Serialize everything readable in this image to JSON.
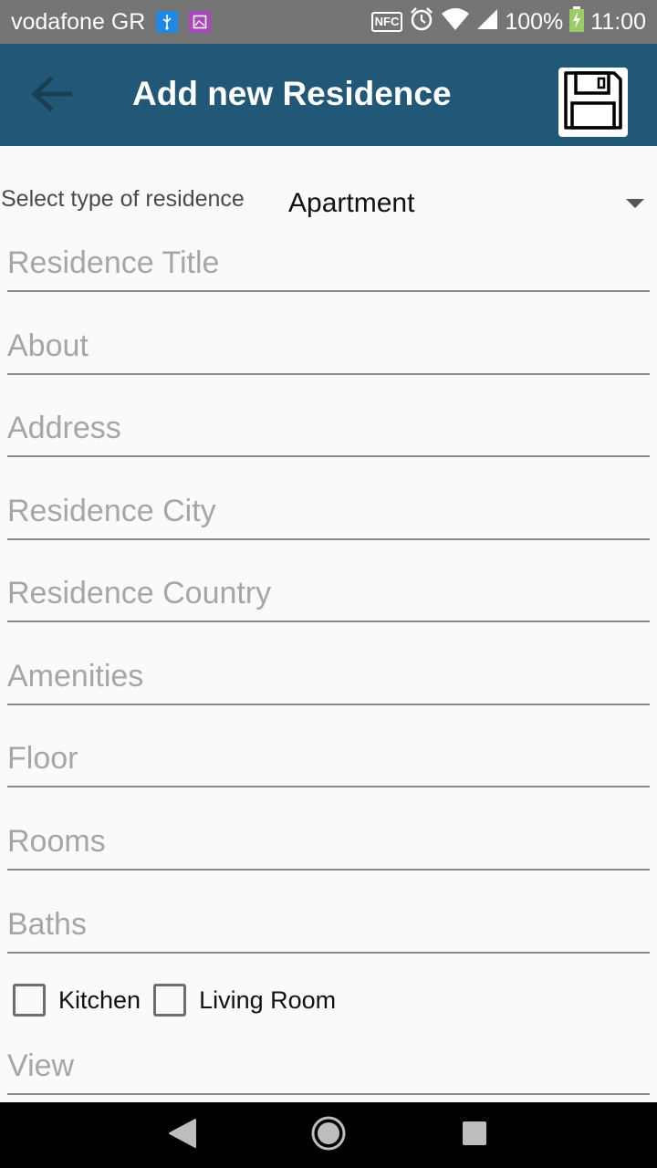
{
  "status_bar": {
    "carrier": "vodafone GR",
    "nfc": "NFC",
    "battery": "100%",
    "time": "11:00"
  },
  "app_bar": {
    "title": "Add new Residence",
    "back_icon": "arrow-left-icon",
    "save_icon": "floppy-disk-icon"
  },
  "residence_type": {
    "label": "Select type of residence",
    "selected": "Apartment"
  },
  "fields": [
    {
      "placeholder": "Residence Title",
      "value": ""
    },
    {
      "placeholder": "About",
      "value": ""
    },
    {
      "placeholder": "Address",
      "value": ""
    },
    {
      "placeholder": "Residence City",
      "value": ""
    },
    {
      "placeholder": "Residence Country",
      "value": ""
    },
    {
      "placeholder": "Amenities",
      "value": ""
    },
    {
      "placeholder": "Floor",
      "value": ""
    },
    {
      "placeholder": "Rooms",
      "value": ""
    },
    {
      "placeholder": "Baths",
      "value": ""
    }
  ],
  "checkboxes": [
    {
      "label": "Kitchen",
      "checked": false
    },
    {
      "label": "Living Room",
      "checked": false
    }
  ],
  "view_field": {
    "placeholder": "View",
    "value": ""
  },
  "colors": {
    "app_bar": "#215777",
    "status_bar": "#757575",
    "background": "#fafafa",
    "nav_bar": "#000000"
  }
}
